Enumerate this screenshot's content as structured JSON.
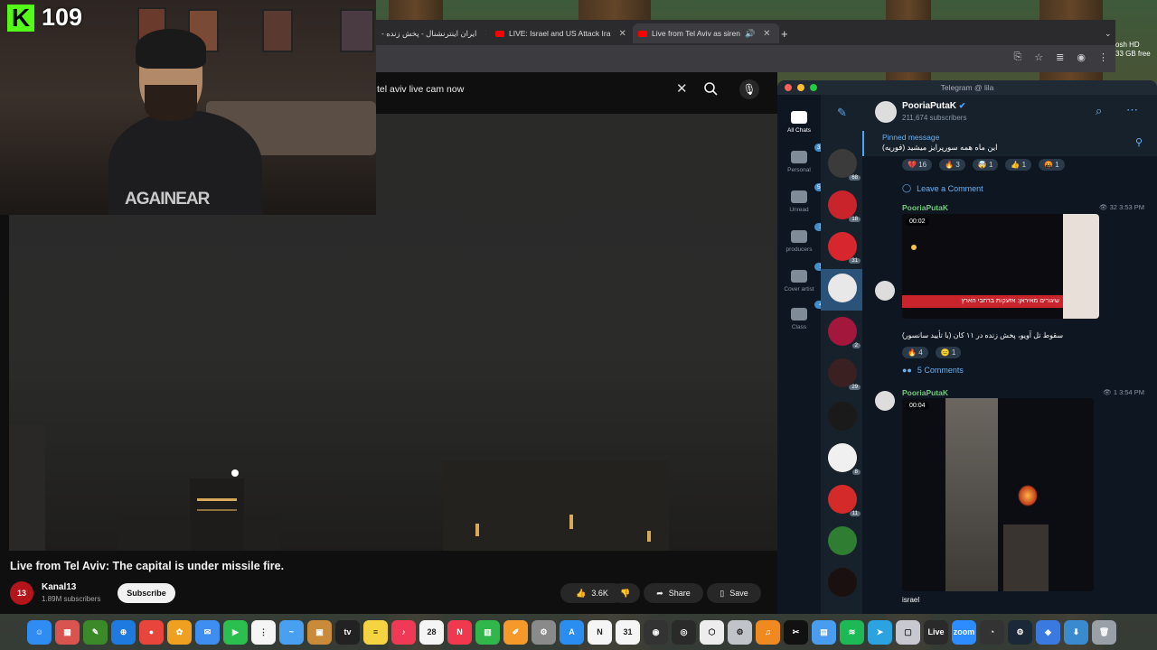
{
  "counter": {
    "logo": "K",
    "value": "109"
  },
  "mac_menu": {
    "line1": "osh HD",
    "line2": "33 GB free"
  },
  "browser": {
    "tabs": [
      {
        "label": "ایران اینترنشنال - پخش زنده -",
        "active": false
      },
      {
        "label": "LIVE: Israel and US Attack Ira",
        "active": false
      },
      {
        "label": "Live from Tel Aviv as siren",
        "active": true
      }
    ],
    "new_tab": "+"
  },
  "youtube": {
    "search": {
      "value": "tel aviv live cam now"
    },
    "video_title": "Live from Tel Aviv: The capital is under missile fire.",
    "channel": {
      "logo": "13",
      "name": "Kanal13",
      "subscribers": "1.89M subscribers"
    },
    "subscribe_label": "Subscribe",
    "likes": "3.6K",
    "share_label": "Share",
    "save_label": "Save"
  },
  "webcam": {
    "hoodie_text": "AGAINEAR"
  },
  "telegram": {
    "window_title": "Telegram @ lila",
    "folders": [
      {
        "label": "All Chats",
        "badge": "",
        "active": true
      },
      {
        "label": "Personal",
        "badge": "394",
        "active": false
      },
      {
        "label": "Unread",
        "badge": "538",
        "active": false
      },
      {
        "label": "producers",
        "badge": "3",
        "active": false
      },
      {
        "label": "Cover artist",
        "badge": "1",
        "active": false
      },
      {
        "label": "Class",
        "badge": "4",
        "active": false
      }
    ],
    "chat_badges": [
      "68",
      "18",
      "31",
      "",
      "2",
      "29",
      "",
      "8",
      "11",
      ""
    ],
    "channel": {
      "name": "PooriaPutaK",
      "subscribers": "211,674 subscribers"
    },
    "pinned": {
      "label": "Pinned message",
      "text": "این ماه همه سورپرایز میشید (فوریه)"
    },
    "top_reactions": [
      {
        "emoji": "💔",
        "count": "16"
      },
      {
        "emoji": "🔥",
        "count": "3"
      },
      {
        "emoji": "🤯",
        "count": "1"
      },
      {
        "emoji": "👍",
        "count": "1"
      },
      {
        "emoji": "🤬",
        "count": "1"
      }
    ],
    "leave_comment": "Leave a Comment",
    "posts": [
      {
        "author": "PooriaPutaK",
        "meta": "32 3:53 PM",
        "duration": "00:02",
        "ticker": "שיגורים מאיראן: אזעקות ברחבי הארץ",
        "caption": "سقوط تل آویو، پخش زنده در ۱۱ کان (با تأیید سانسور)",
        "reactions": [
          {
            "emoji": "🔥",
            "count": "4"
          },
          {
            "emoji": "😐",
            "count": "1"
          }
        ],
        "comments": "5 Comments"
      },
      {
        "author": "PooriaPutaK",
        "meta": "1 3:54 PM",
        "duration": "00:04",
        "caption": "israel"
      }
    ]
  },
  "dock": {
    "items": [
      {
        "name": "finder",
        "color": "#2f8cf2",
        "glyph": "☺"
      },
      {
        "name": "launchpad",
        "color": "#d9534f",
        "glyph": "▦"
      },
      {
        "name": "app",
        "color": "#3a8a2a",
        "glyph": "✎"
      },
      {
        "name": "safari",
        "color": "#1f7ae0",
        "glyph": "⊕"
      },
      {
        "name": "chrome",
        "color": "#e8453c",
        "glyph": "●"
      },
      {
        "name": "photos",
        "color": "#f0a020",
        "glyph": "✿"
      },
      {
        "name": "mail",
        "color": "#3d8ef0",
        "glyph": "✉"
      },
      {
        "name": "facetime",
        "color": "#2bbf4f",
        "glyph": "▶"
      },
      {
        "name": "reminders",
        "color": "#f5f5f5",
        "glyph": "⋮"
      },
      {
        "name": "freeform",
        "color": "#4aa0f0",
        "glyph": "~"
      },
      {
        "name": "folder",
        "color": "#c98a3a",
        "glyph": "▣"
      },
      {
        "name": "apple-tv",
        "color": "#222222",
        "glyph": "tv"
      },
      {
        "name": "notes",
        "color": "#f5d442",
        "glyph": "≡"
      },
      {
        "name": "music",
        "color": "#f03a55",
        "glyph": "♪"
      },
      {
        "name": "calendar",
        "color": "#f5f5f5",
        "glyph": "28"
      },
      {
        "name": "news",
        "color": "#f0384e",
        "glyph": "N"
      },
      {
        "name": "numbers",
        "color": "#30b64a",
        "glyph": "▥"
      },
      {
        "name": "pages",
        "color": "#f59a2a",
        "glyph": "✐"
      },
      {
        "name": "system-settings",
        "color": "#8a8a8a",
        "glyph": "⚙"
      },
      {
        "name": "app-store",
        "color": "#2a8ef0",
        "glyph": "A"
      },
      {
        "name": "notion",
        "color": "#f5f5f5",
        "glyph": "N"
      },
      {
        "name": "calendar-31",
        "color": "#f5f5f5",
        "glyph": "31"
      },
      {
        "name": "logic",
        "color": "#333333",
        "glyph": "◉"
      },
      {
        "name": "logic-2",
        "color": "#2a2a2a",
        "glyph": "◎"
      },
      {
        "name": "unity",
        "color": "#ededed",
        "glyph": "⬡"
      },
      {
        "name": "utility",
        "color": "#c0c4c8",
        "glyph": "⚙"
      },
      {
        "name": "garageband",
        "color": "#f08a20",
        "glyph": "♫"
      },
      {
        "name": "capcut",
        "color": "#111111",
        "glyph": "✂"
      },
      {
        "name": "preview",
        "color": "#4a9cf0",
        "glyph": "▤"
      },
      {
        "name": "spotify",
        "color": "#1db954",
        "glyph": "≋"
      },
      {
        "name": "telegram",
        "color": "#2aa3e0",
        "glyph": "➤"
      },
      {
        "name": "scripts",
        "color": "#c8c8d0",
        "glyph": "▢"
      },
      {
        "name": "live",
        "color": "#2a2a2a",
        "glyph": "Live"
      },
      {
        "name": "zoom",
        "color": "#2d8cff",
        "glyph": "zoom"
      },
      {
        "name": "activity",
        "color": "#333333",
        "glyph": "◔"
      },
      {
        "name": "steam",
        "color": "#1b2838",
        "glyph": "⚙"
      },
      {
        "name": "vpn",
        "color": "#3a7ae0",
        "glyph": "◈"
      },
      {
        "name": "downloads",
        "color": "#3a8ad0",
        "glyph": "⬇"
      },
      {
        "name": "trash",
        "color": "#9aa0a8",
        "glyph": "🗑"
      }
    ]
  }
}
